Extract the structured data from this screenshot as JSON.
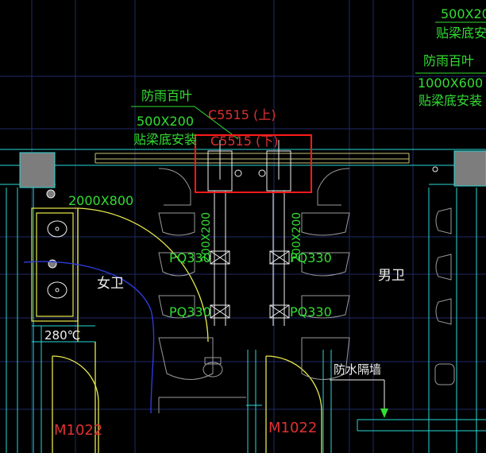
{
  "colors": {
    "background": "#000000",
    "grid": "#1f2a66",
    "wall": "#2ad8d8",
    "door": "#e8e84a",
    "green_text": "#33dd33",
    "red_text": "#e03030",
    "white_text": "#f0f0f0",
    "fixture": "#9a9a9a",
    "duct": "#c9c277",
    "pipe": "#2d3bd9",
    "highlight_box": "#ff1a1a"
  },
  "labels": {
    "top_right_size": "500X20",
    "top_right_note": "贴梁底安",
    "right_louver_title": "防雨百叶",
    "right_louver_size": "1000X600",
    "right_louver_note": "贴梁底安装",
    "left_louver_title": "防雨百叶",
    "left_louver_size": "500X200",
    "left_louver_note": "贴梁底安装",
    "fan_upper": "C5515 (上)",
    "fan_lower": "C5515 (下)",
    "window_size": "2000X800",
    "womens_room": "女卫",
    "mens_room": "男卫",
    "pipe_labels": [
      "PQ330",
      "PQ330",
      "PQ330",
      "PQ330"
    ],
    "duct_labels": [
      "200X200",
      "200X200"
    ],
    "temperature_mark": "280℃",
    "door_left": "M1022",
    "door_mid": "M1022",
    "waterproof_wall": "防水隔墙"
  },
  "icons": [
    "exhaust-fan-icon",
    "toilet-icon",
    "urinal-icon",
    "washbasin-icon",
    "arrow-down-icon"
  ]
}
